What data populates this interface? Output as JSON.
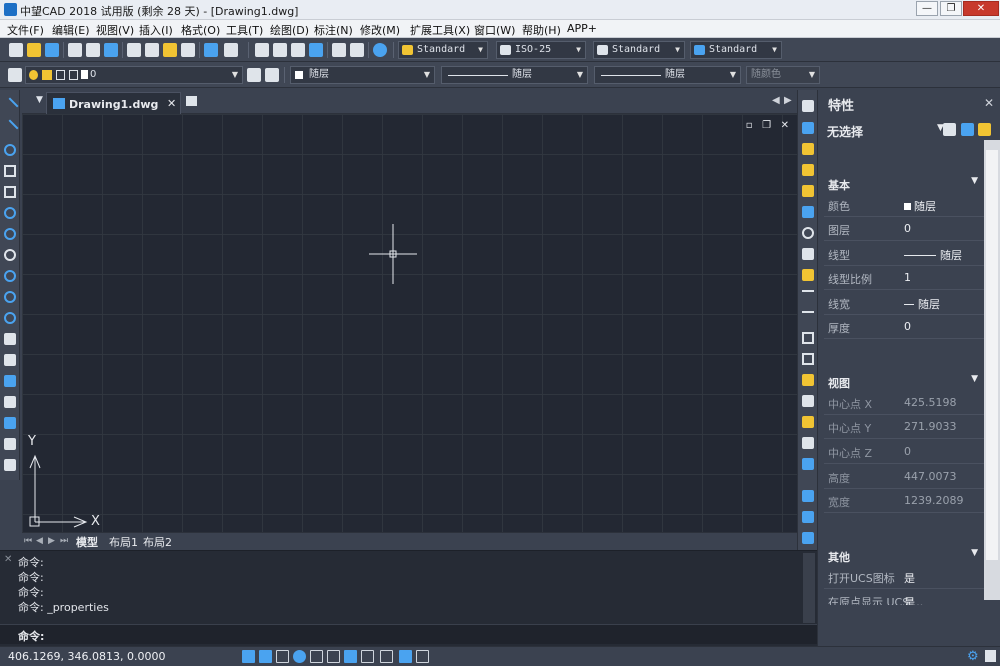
{
  "window": {
    "title": "中望CAD 2018 试用版 (剩余 28 天) - [Drawing1.dwg]",
    "controls": {
      "minimize": "—",
      "restore": "❐",
      "close": "✕"
    }
  },
  "menubar": {
    "items": [
      "文件(F)",
      "编辑(E)",
      "视图(V)",
      "插入(I)",
      "格式(O)",
      "工具(T)",
      "绘图(D)",
      "标注(N)",
      "修改(M)",
      "扩展工具(X)",
      "窗口(W)",
      "帮助(H)",
      "APP+"
    ]
  },
  "toolbar1": {
    "text_style": "Standard",
    "dim_style": "ISO-25",
    "table_style": "Standard",
    "mleader_style": "Standard"
  },
  "toolbar2": {
    "layer": "0",
    "color": "随层",
    "linetype": "随层",
    "lineweight": "随层",
    "plotstyle": "随颜色"
  },
  "drawing_tab": {
    "label": "Drawing1.dwg",
    "close": "✕"
  },
  "canvas": {
    "axis_y": "Y",
    "axis_x": "X",
    "ctrl_min": "▫",
    "ctrl_restore": "❐",
    "ctrl_close": "✕"
  },
  "layout_tabs": [
    "模型",
    "布局1",
    "布局2"
  ],
  "command": {
    "history": [
      "命令:",
      "命令:",
      "命令:",
      "命令: _properties"
    ],
    "prompt": "命令:"
  },
  "status": {
    "coordinates": "406.1269, 346.0813, 0.0000"
  },
  "properties": {
    "title": "特性",
    "close": "✕",
    "selection": "无选择",
    "sections": {
      "basic": {
        "title": "基本",
        "rows": [
          {
            "key": "颜色",
            "value": "随层"
          },
          {
            "key": "图层",
            "value": "0"
          },
          {
            "key": "线型",
            "value": "随层"
          },
          {
            "key": "线型比例",
            "value": "1"
          },
          {
            "key": "线宽",
            "value": "随层"
          },
          {
            "key": "厚度",
            "value": "0"
          }
        ]
      },
      "view": {
        "title": "视图",
        "rows": [
          {
            "key": "中心点 X",
            "value": "425.5198"
          },
          {
            "key": "中心点 Y",
            "value": "271.9033"
          },
          {
            "key": "中心点 Z",
            "value": "0"
          },
          {
            "key": "高度",
            "value": "447.0073"
          },
          {
            "key": "宽度",
            "value": "1239.2089"
          }
        ]
      },
      "misc": {
        "title": "其他",
        "rows": [
          {
            "key": "打开UCS图标",
            "value": "是"
          },
          {
            "key": "在原点显示 UCS ...",
            "value": "是"
          }
        ]
      }
    }
  },
  "colors": {
    "canvas_bg": "#232833",
    "panel_bg": "#3b4250",
    "accent": "#4aa3f0"
  }
}
